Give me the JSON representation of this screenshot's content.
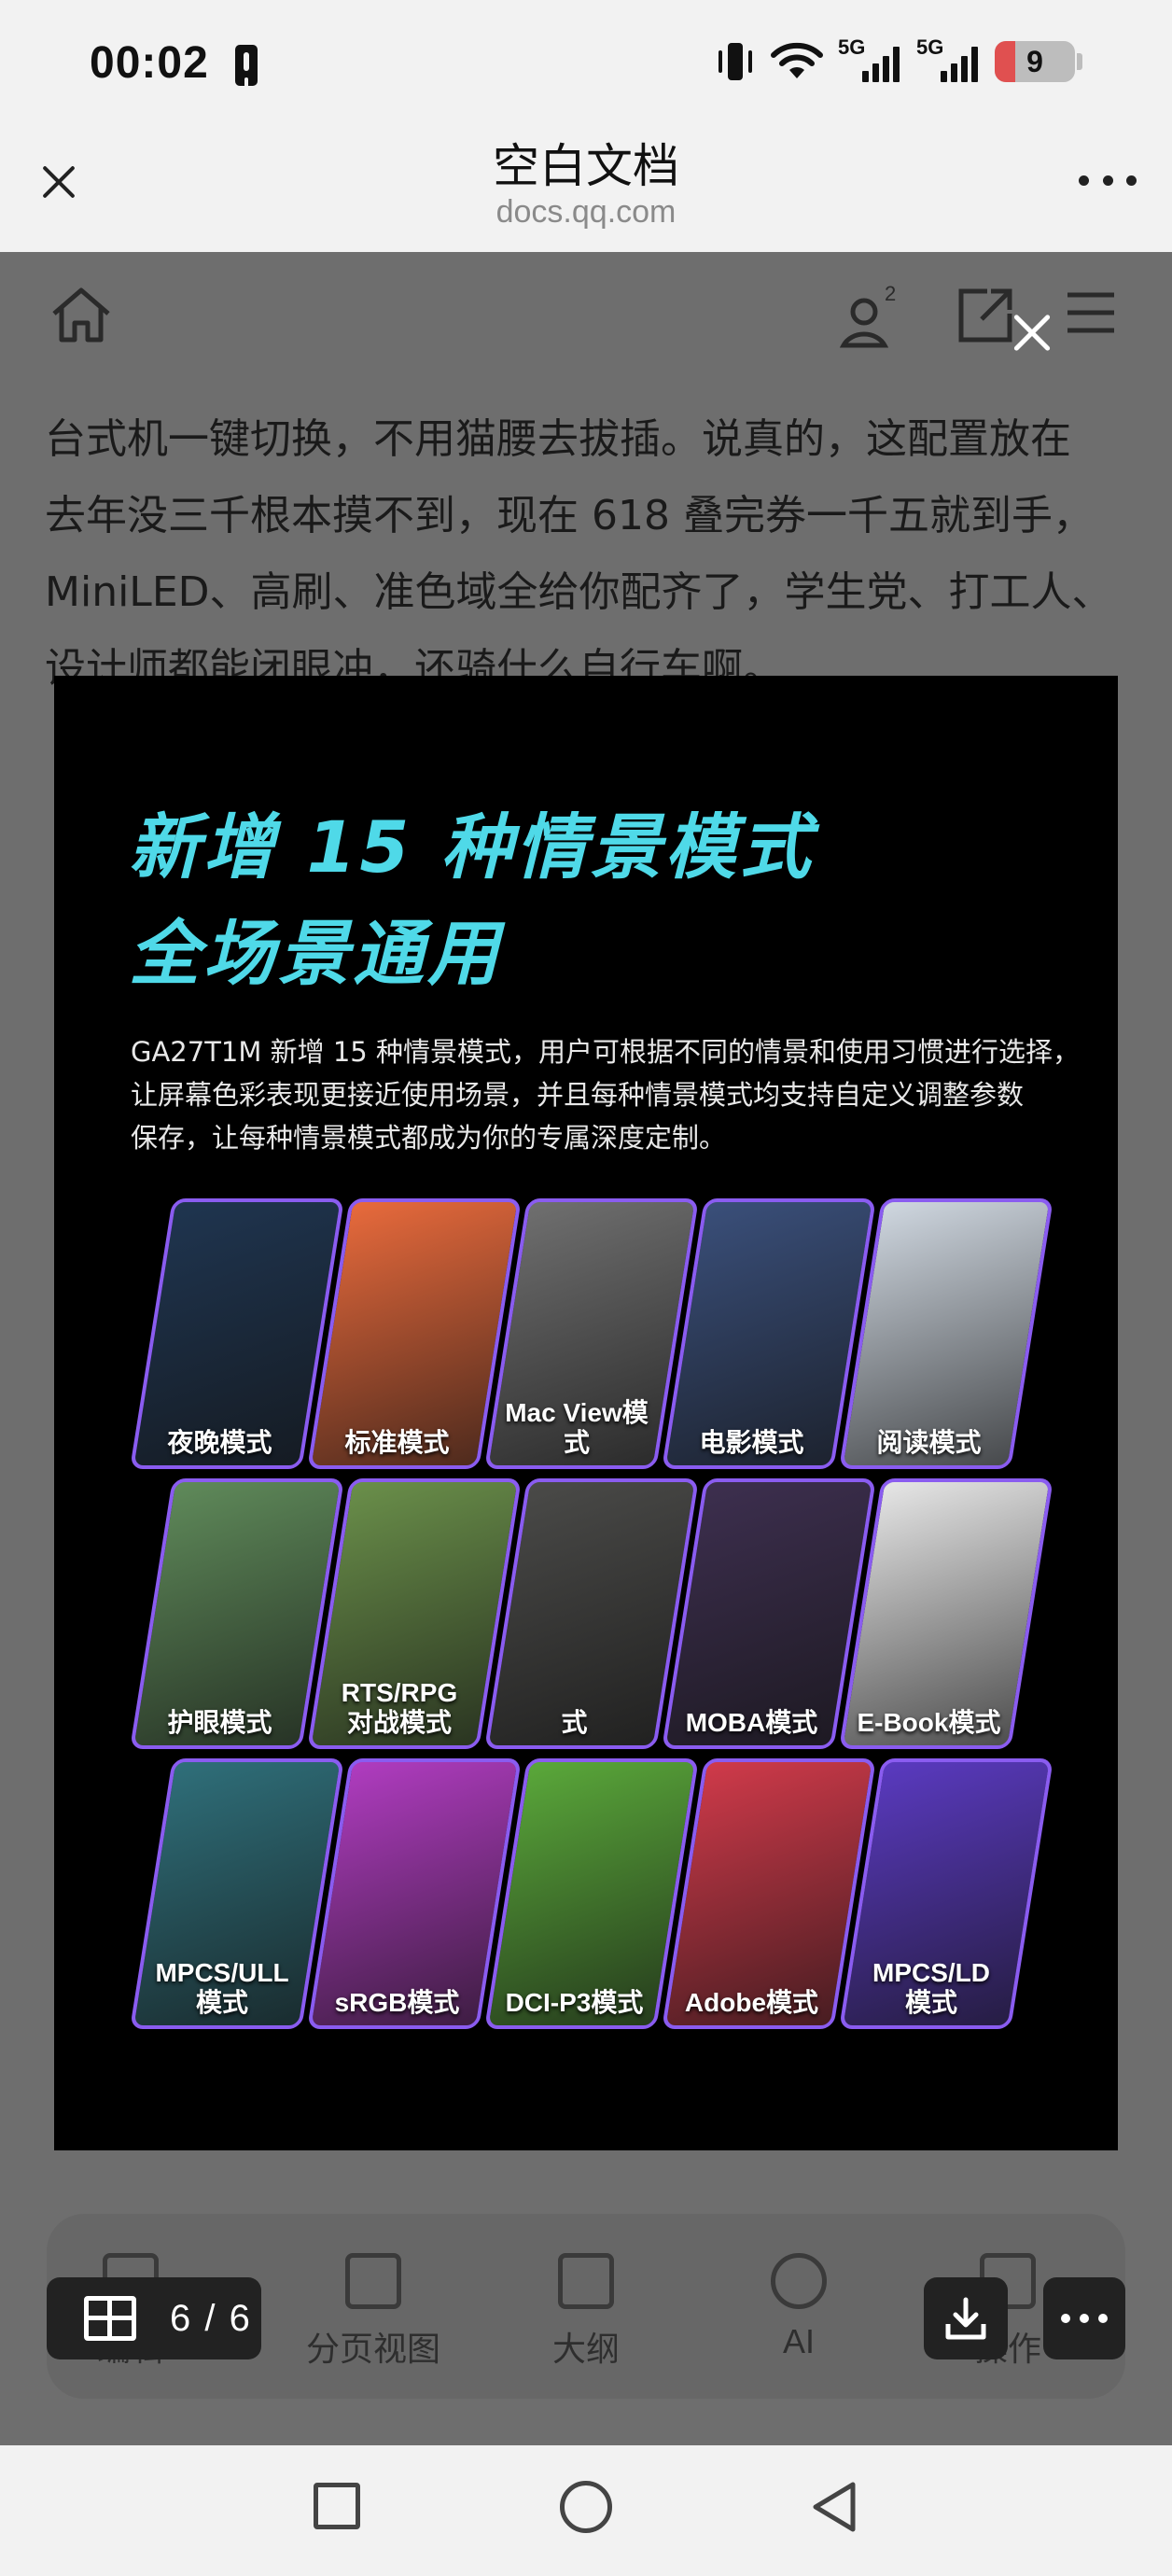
{
  "status_bar": {
    "time": "00:02",
    "signal_1_label": "5G",
    "signal_2_label": "5G",
    "battery_level": "9",
    "battery_color": "#e05050"
  },
  "browser": {
    "title": "空白文档",
    "domain": "docs.qq.com",
    "close_icon": "close-icon",
    "more_icon": "more-icon"
  },
  "doc_toolbar": {
    "home_icon": "home-icon",
    "user_icon": "user-icon",
    "user_badge": "2",
    "share_icon": "share-icon",
    "menu_icon": "menu-icon"
  },
  "document": {
    "paragraph_lines": [
      "台式机一键切换，不用猫腰去拔插。说真的，这配置放在",
      "去年没三千根本摸不到，现在 618 叠完券一千五就到手，",
      "MiniLED、高刷、准色域全给你配齐了，学生党、打工人、",
      "设计师都能闭眼冲，还骑什么自行车啊。"
    ]
  },
  "image_viewer": {
    "close_icon": "close-icon",
    "image": {
      "title_line_1": "新增 15 种情景模式",
      "title_line_2": "全场景通用",
      "description_lines": [
        "GA27T1M 新增 15 种情景模式，用户可根据不同的情景和使用习惯进行选择，",
        "让屏幕色彩表现更接近使用场景，并且每种情景模式均支持自定义调整参数",
        "保存，让每种情景模式都成为你的专属深度定制。"
      ],
      "modes": [
        {
          "label": "夜晚模式",
          "color": "#1f3550"
        },
        {
          "label": "标准模式",
          "color": "#e86a3c"
        },
        {
          "label": "Mac View模式",
          "color": "#6f6f6f"
        },
        {
          "label": "电影模式",
          "color": "#3a4f7a"
        },
        {
          "label": "阅读模式",
          "color": "#cfd7e0"
        },
        {
          "label": "护眼模式",
          "color": "#5f8a5a"
        },
        {
          "label": "RTS/RPG\n对战模式",
          "color": "#6a8f4a"
        },
        {
          "label": "式",
          "color": "#4a4a48"
        },
        {
          "label": "MOBA模式",
          "color": "#3d2f4f"
        },
        {
          "label": "E-Book模式",
          "color": "#e6e6e6"
        },
        {
          "label": "MPCS/ULL\n模式",
          "color": "#2f6f7a"
        },
        {
          "label": "sRGB模式",
          "color": "#b03cc0"
        },
        {
          "label": "DCI-P3模式",
          "color": "#5aa83a"
        },
        {
          "label": "Adobe模式",
          "color": "#d03a4a"
        },
        {
          "label": "MPCS/LD\n模式",
          "color": "#5a3ac0"
        }
      ]
    },
    "page_counter": "6 / 6",
    "download_icon": "download-icon",
    "more_icon": "more-icon"
  },
  "bottom_toolbar": {
    "items": [
      {
        "label": "编辑",
        "icon": "edit-icon"
      },
      {
        "label": "分页视图",
        "icon": "page-view-icon"
      },
      {
        "label": "大纲",
        "icon": "outline-icon"
      },
      {
        "label": "AI",
        "icon": "ai-icon"
      },
      {
        "label": "操作",
        "icon": "actions-icon"
      }
    ]
  },
  "nav_bar": {
    "recents_icon": "recents-icon",
    "home_icon": "home-nav-icon",
    "back_icon": "back-icon"
  }
}
